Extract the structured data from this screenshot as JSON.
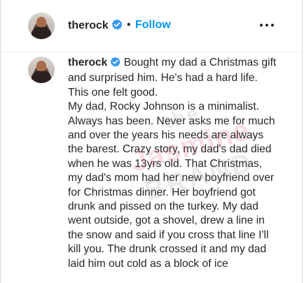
{
  "header": {
    "username": "therock",
    "separator": "•",
    "follow_label": "Follow",
    "more_icon": "more-options-icon"
  },
  "post": {
    "username": "therock",
    "caption": "Bought my dad a Christmas gift and surprised him. He's had a hard life. This one felt good.\nMy dad, Rocky Johnson is a minimalist. Always has been. Never asks me for much and over the years his needs are always the barest. Crazy story, my dad's dad died when he was 13yrs old. That Christmas, my dad's mom had her new boyfriend over for Christmas dinner. Her boyfriend got drunk and pissed on the turkey. My dad went outside, got a shovel, drew a line in the snow and said if you cross that line I'll kill you. The drunk crossed it and my dad laid him out cold as a block of ice"
  },
  "watermark": {
    "line1": "the",
    "line2": "Jasmine",
    "line3": "BRAND"
  },
  "colors": {
    "text": "#262626",
    "link_blue": "#0095f6",
    "verified_blue": "#3897f0",
    "divider": "#efefef"
  }
}
